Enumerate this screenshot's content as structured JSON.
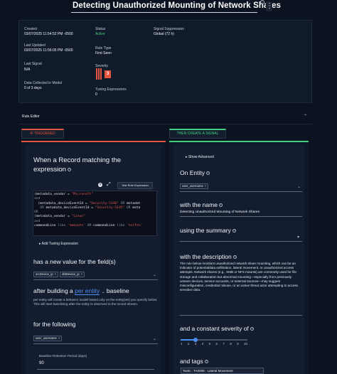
{
  "header": {
    "title": "Detecting Unauthorized Mounting of Network Shares",
    "info_glyph": "i",
    "menu_glyph": "⋮"
  },
  "summary": {
    "created_label": "Created",
    "created_value": "03/07/2025 11:54:52 PM -0500",
    "updated_label": "Last Updated",
    "updated_value": "03/07/2025 11:56:05 PM -0500",
    "last_signal_label": "Last Signal",
    "last_signal_value": "N/A",
    "collected_label": "Data Collected in Model",
    "collected_value": "0 of 3 days",
    "status_label": "Status",
    "status_value": "Active",
    "rule_type_label": "Rule Type",
    "rule_type_value": "First Seen",
    "severity_label": "Severity",
    "severity_value": "3",
    "tuning_label": "Tuning Expressions",
    "tuning_value": "0",
    "suppression_label": "Signal Suppression",
    "suppression_value": "Global (72 h)"
  },
  "editor": {
    "title": "Rule Editor",
    "collapse_glyph": "⌃",
    "if_tab": "IF TRIGGERED",
    "then_tab": "THEN CREATE A SIGNAL"
  },
  "left": {
    "heading": "When a Record matching the expression",
    "test_button": "Test Rule Expression",
    "code_lines": [
      [
        {
          "t": "(metadata_vendor = ",
          "c": "txt"
        },
        {
          "t": "\"Microsoft\"",
          "c": "str"
        }
      ],
      [
        {
          "t": "and",
          "c": "kw"
        }
      ],
      [
        {
          "t": "  (metadata_deviceEventId = ",
          "c": "txt"
        },
        {
          "t": "\"Security-5140\"",
          "c": "str"
        },
        {
          "t": " OR ",
          "c": "kw"
        },
        {
          "t": "metadat",
          "c": "txt"
        }
      ],
      [
        {
          "t": "   OR ",
          "c": "kw"
        },
        {
          "t": "metadata_deviceEventId = ",
          "c": "txt"
        },
        {
          "t": "\"Security-5145\"",
          "c": "str"
        },
        {
          "t": " OR ",
          "c": "kw"
        },
        {
          "t": "meta",
          "c": "txt"
        }
      ],
      [
        {
          "t": "OR",
          "c": "kw"
        }
      ],
      [
        {
          "t": "(metadata_vendor = ",
          "c": "txt"
        },
        {
          "t": "\"Linux\"",
          "c": "str"
        }
      ],
      [
        {
          "t": "and",
          "c": "kw"
        }
      ],
      [
        {
          "t": "commandLine ",
          "c": "txt"
        },
        {
          "t": "like ",
          "c": "kw"
        },
        {
          "t": "'%mount%'",
          "c": "str"
        },
        {
          "t": " OR ",
          "c": "kw"
        },
        {
          "t": "commandLine ",
          "c": "txt"
        },
        {
          "t": "like ",
          "c": "kw"
        },
        {
          "t": "'%cifs%'",
          "c": "str"
        }
      ]
    ],
    "add_tuning": "Add Tuning Expression",
    "new_value_heading": "has a new value for the field(s)",
    "fields": [
      "srcDevice_ip",
      "dstDevice_ip"
    ],
    "after_building": "after building a",
    "per_entity": "per entity",
    "baseline": "baseline",
    "baseline_desc": "per entity will create a behavior model based only on the entity(ies) you specify below. This will start baselining after the entity is observed in the record stream.",
    "for_following": "for the following",
    "entity_chip": "user_username",
    "retention_label": "Baseline Retention Period (days)",
    "retention_value": "90"
  },
  "right": {
    "show_advanced": "Show Advanced",
    "on_entity": "On Entity",
    "entity_chip": "user_username",
    "with_name": "with the name",
    "name_value": "Detecting Unauthorized Mounting of Network Shares",
    "using_summary": "using the summary",
    "with_description": "with the description",
    "description": "The rule below monitors unauthorized network share mounting, which can be an indicator of potentialdata exfiltration, lateral movement, or unauthorized access attempts. Network shares (e.g., SMB or NFS mounts) are commonly used for file storage and collaboration but abnormal mounting—especially from previously unseen devices, service accounts, or external sources—may suggest misconfiguration, credential misuse, or an active threat actor attempting to access sensitive data.",
    "severity_heading": "and a constant severity of",
    "severity_scale": [
      "1",
      "2",
      "3",
      "4",
      "5",
      "6",
      "7",
      "8",
      "9",
      "10"
    ],
    "severity_level": 3,
    "tags_heading": "and tags",
    "tactic_chip": "Tactic : TA0008 - Lateral Movement"
  },
  "colors": {
    "accent_red": "#e4563d",
    "accent_green": "#3fd281",
    "accent_blue": "#4a8cf0"
  }
}
